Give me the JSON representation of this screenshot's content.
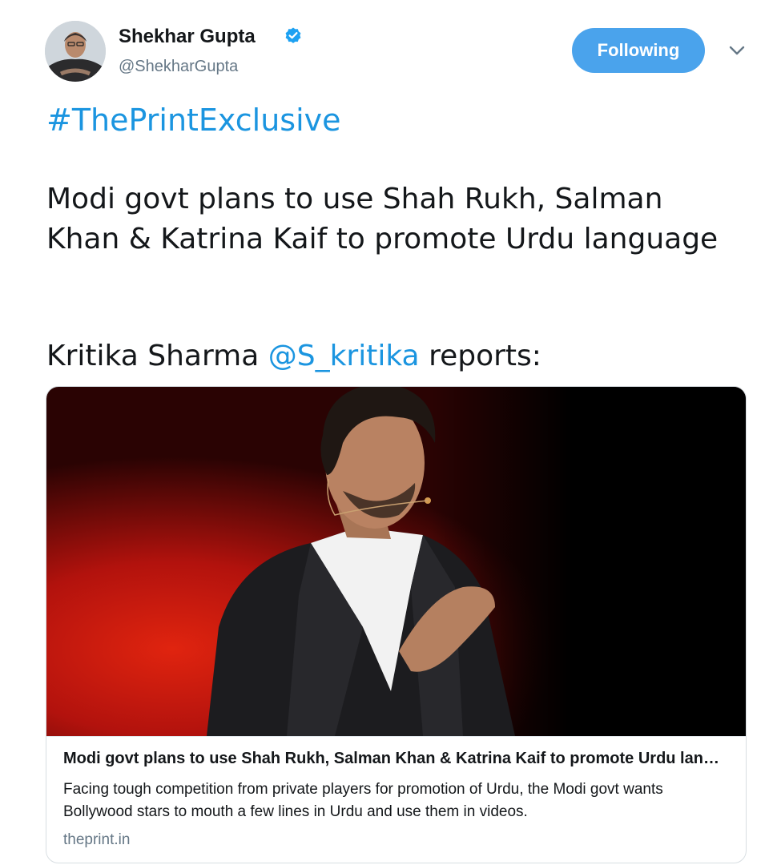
{
  "author": {
    "name": "Shekhar Gupta",
    "handle": "@ShekharGupta",
    "verified": true
  },
  "follow_button": {
    "label": "Following",
    "color": "#4aa3ec"
  },
  "tweet": {
    "hashtag": "#ThePrintExclusive",
    "body": "Modi govt plans to use Shah Rukh, Salman Khan & Katrina Kaif to promote Urdu language",
    "reports_prefix": "Kritika Sharma ",
    "mention": "@S_kritika",
    "reports_suffix": " reports:"
  },
  "card": {
    "title": "Modi govt plans to use Shah Rukh, Salman Khan & Katrina Kaif to promote Urdu language",
    "description": "Facing tough competition from private players for promotion of Urdu, the Modi govt wants Bollywood stars to mouth a few lines in Urdu and use them in videos.",
    "domain": "theprint.in"
  },
  "colors": {
    "link": "#1b95e0",
    "secondary_text": "#657786",
    "primary_text": "#14171a"
  },
  "icons": {
    "verified": "verified-badge-icon",
    "caret": "chevron-down-icon"
  }
}
